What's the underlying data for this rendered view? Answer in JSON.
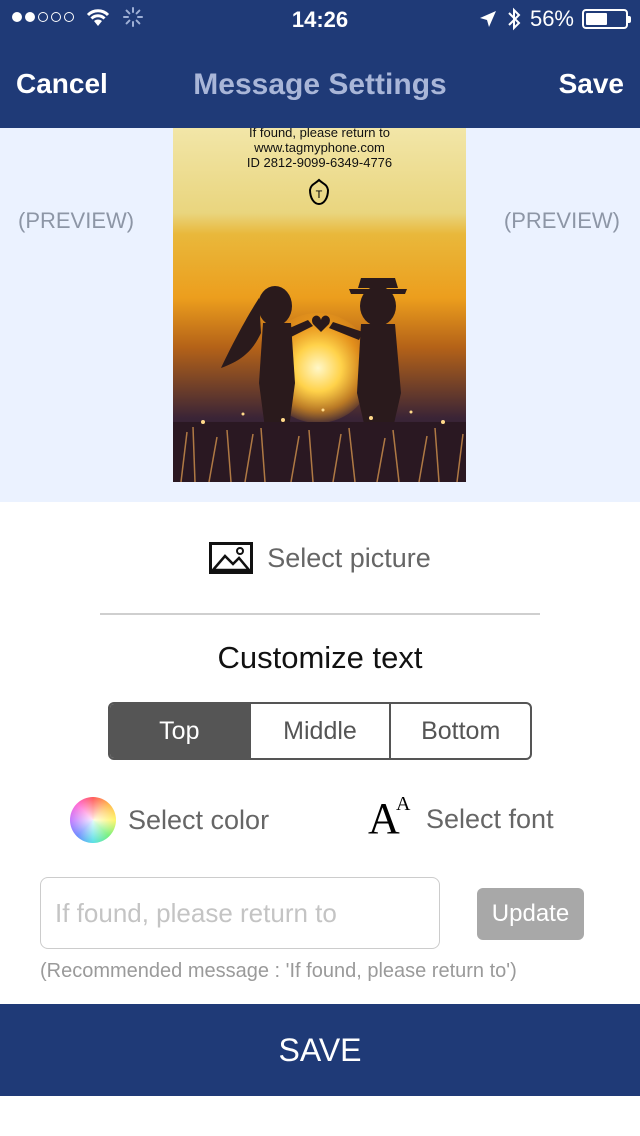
{
  "status_bar": {
    "time": "14:26",
    "battery_percent": "56%",
    "battery_level": 0.56,
    "signal_bars_filled": 2,
    "signal_bars_total": 5
  },
  "navbar": {
    "cancel_label": "Cancel",
    "title": "Message Settings",
    "save_label": "Save"
  },
  "preview": {
    "left_label": "(PREVIEW)",
    "right_label": "(PREVIEW)",
    "lines": [
      "If found, please return to",
      "www.tagmyphone.com",
      "ID 2812-9099-6349-4776"
    ],
    "logo_letter": "T"
  },
  "select_picture_label": "Select picture",
  "customize_title": "Customize text",
  "position_tabs": [
    {
      "label": "Top",
      "active": true
    },
    {
      "label": "Middle",
      "active": false
    },
    {
      "label": "Bottom",
      "active": false
    }
  ],
  "select_color_label": "Select color",
  "select_font_label": "Select font",
  "font_icon": {
    "big": "A",
    "small": "A"
  },
  "message_input": {
    "value": "",
    "placeholder": "If found, please return to"
  },
  "update_label": "Update",
  "recommended_note": "(Recommended message : 'If found, please return to')",
  "save_bar_label": "SAVE",
  "colors": {
    "brand_navy": "#1f3a77",
    "preview_bg": "#ebf2ff",
    "active_segment": "#555555",
    "update_button": "#a8a8a8"
  }
}
